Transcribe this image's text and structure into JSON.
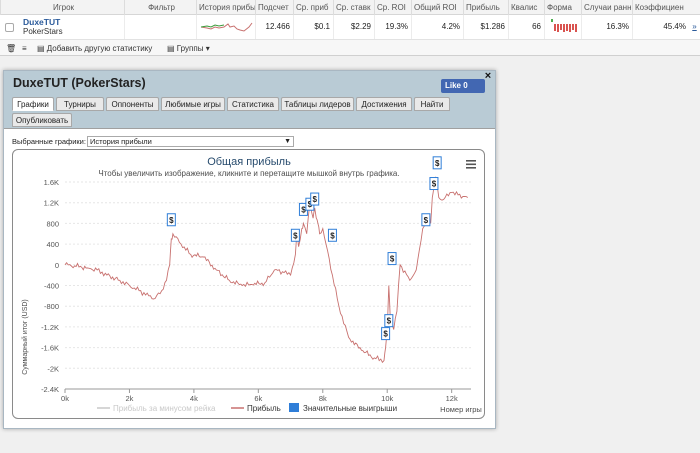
{
  "table": {
    "headers": [
      "Игрок",
      "Фильтр",
      "История прибыль",
      "Подсчет",
      "Ср. приб",
      "Ср. ставк",
      "Ср. ROI",
      "Общий ROI",
      "Прибыль",
      "Квалис",
      "Форма",
      "Случаи ранн",
      "Коэффициен"
    ],
    "row": {
      "player": "DuxeTUT",
      "site": "PokerStars",
      "count": "12.466",
      "avg_profit": "$0.1",
      "avg_stake": "$2.29",
      "avg_roi": "19.3%",
      "total_roi": "4.2%",
      "profit": "$1.286",
      "itm": "66",
      "early": "16.3%",
      "coef": "45.4%",
      "more": "»"
    }
  },
  "toolbar": {
    "add_stats": "Добавить другую статистику",
    "groups": "Группы"
  },
  "popup": {
    "title": "DuxeTUT (PokerStars)",
    "like": "Like 0",
    "close": "×",
    "tabs": [
      "Графики",
      "Турниры",
      "Оппоненты",
      "Любимые игры",
      "Статистика",
      "Таблицы лидеров",
      "Достижения",
      "Найти",
      "Опубликовать"
    ],
    "select_label": "Выбранные графики:",
    "select_value": "История прибыли"
  },
  "chart_data": {
    "type": "line",
    "title": "Общая прибыль",
    "subtitle": "Чтобы увеличить изображение, кликните и перетащите мышкой внутрь графика.",
    "xlabel": "Номер игры",
    "ylabel": "Суммарный итог (USD)",
    "xlim": [
      0,
      12600
    ],
    "ylim": [
      -2400,
      1600
    ],
    "xticks": [
      "0k",
      "2k",
      "4k",
      "6k",
      "8k",
      "10k",
      "12k"
    ],
    "yticks": [
      "1.6K",
      "1.2K",
      "800",
      "400",
      "0",
      "-400",
      "-800",
      "-1.2K",
      "-1.6K",
      "-2K",
      "-2.4K"
    ],
    "legend": [
      "Прибыль за минусом рейка",
      "Прибыль",
      "Значительные выигрыши"
    ],
    "colors": {
      "profit": "#c8716f",
      "rake": "#c9c9c9",
      "big_win": "#2f7ed8"
    },
    "series": [
      {
        "name": "Прибыль",
        "x": [
          0,
          300,
          700,
          1000,
          1300,
          1700,
          2000,
          2300,
          2600,
          2800,
          3000,
          3150,
          3250,
          3300,
          3350,
          3600,
          3900,
          4300,
          4700,
          5100,
          5500,
          5800,
          6200,
          6500,
          6800,
          7000,
          7150,
          7200,
          7250,
          7350,
          7400,
          7500,
          7600,
          7700,
          7750,
          7800,
          7850,
          7900,
          8000,
          8100,
          8300,
          8500,
          8800,
          9200,
          9600,
          9900,
          9950,
          10000,
          10050,
          10100,
          10150,
          10200,
          10300,
          10400,
          10700,
          10900,
          10950,
          11100,
          11200,
          11300,
          11350,
          11400,
          11450,
          11500,
          11600,
          11700,
          12000,
          12200,
          12500
        ],
        "y": [
          0,
          -20,
          -60,
          -100,
          -200,
          -300,
          -400,
          -500,
          -600,
          -650,
          -500,
          -300,
          0,
          500,
          600,
          400,
          200,
          150,
          -100,
          -300,
          -400,
          -380,
          -350,
          -100,
          -150,
          -200,
          200,
          600,
          350,
          700,
          800,
          600,
          1200,
          900,
          1100,
          900,
          800,
          600,
          700,
          400,
          -200,
          -800,
          -1400,
          -1650,
          -1800,
          -1850,
          -1600,
          -1300,
          -400,
          -1100,
          -1150,
          -1250,
          -900,
          0,
          -300,
          -100,
          100,
          700,
          800,
          950,
          800,
          1300,
          1500,
          1700,
          1300,
          1250,
          1400,
          1350,
          1300
        ]
      }
    ],
    "big_wins": [
      {
        "x": 3300,
        "y": 600
      },
      {
        "x": 7150,
        "y": 300
      },
      {
        "x": 7400,
        "y": 800
      },
      {
        "x": 7600,
        "y": 900
      },
      {
        "x": 7750,
        "y": 1000
      },
      {
        "x": 8300,
        "y": 300
      },
      {
        "x": 9950,
        "y": -1600
      },
      {
        "x": 10050,
        "y": -1350
      },
      {
        "x": 10150,
        "y": -150
      },
      {
        "x": 11200,
        "y": 600
      },
      {
        "x": 11450,
        "y": 1300
      },
      {
        "x": 11550,
        "y": 1700
      }
    ]
  }
}
